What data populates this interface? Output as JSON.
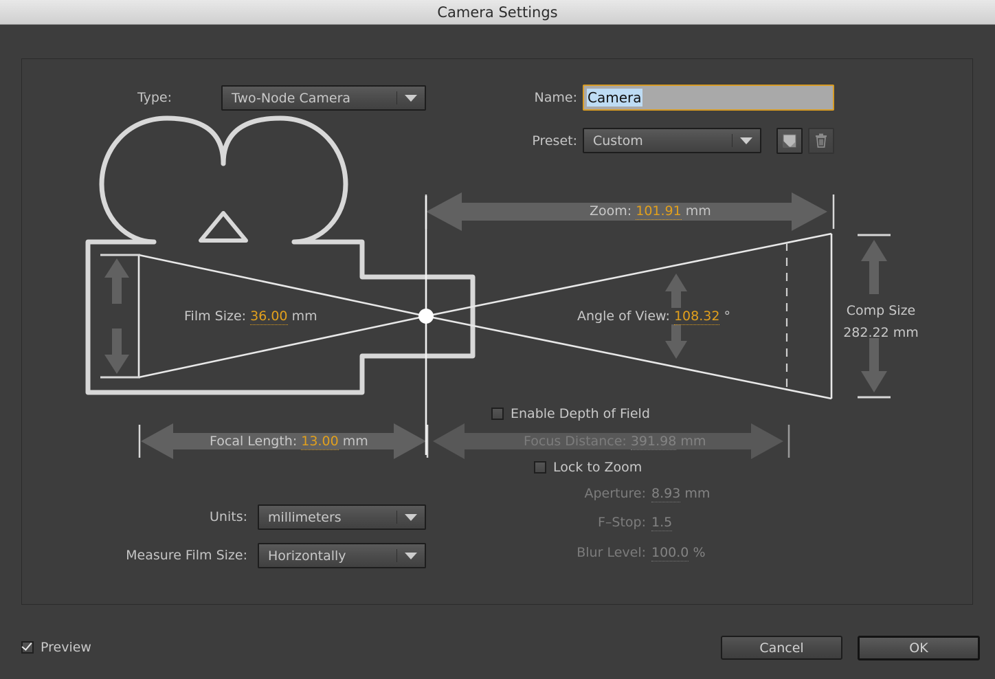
{
  "window": {
    "title": "Camera Settings"
  },
  "form": {
    "type_label": "Type:",
    "type_value": "Two-Node Camera",
    "name_label": "Name:",
    "name_value": "Camera",
    "name_placeholder": "Camera",
    "preset_label": "Preset:",
    "preset_value": "Custom",
    "save_preset_icon": "save-preset-icon",
    "delete_preset_icon": "trash-icon",
    "units_label": "Units:",
    "units_value": "millimeters",
    "measure_film_size_label": "Measure Film Size:",
    "measure_film_size_value": "Horizontally"
  },
  "diagram": {
    "zoom_label": "Zoom:",
    "zoom_value": "101.91",
    "zoom_unit": "mm",
    "film_size_label": "Film Size:",
    "film_size_value": "36.00",
    "film_size_unit": "mm",
    "angle_of_view_label": "Angle of View:",
    "angle_of_view_value": "108.32",
    "angle_of_view_unit": "°",
    "comp_size_label": "Comp Size",
    "comp_size_value": "282.22 mm",
    "focal_length_label": "Focal Length:",
    "focal_length_value": "13.00",
    "focal_length_unit": "mm",
    "focus_distance_label": "Focus Distance:",
    "focus_distance_value": "391.98",
    "focus_distance_unit": "mm"
  },
  "dof": {
    "enable_label": "Enable Depth of Field",
    "enable_checked": false,
    "lock_to_zoom_label": "Lock to Zoom",
    "lock_to_zoom_checked": false,
    "aperture_label": "Aperture:",
    "aperture_value": "8.93",
    "aperture_unit": "mm",
    "fstop_label": "F–Stop:",
    "fstop_value": "1.5",
    "blur_label": "Blur Level:",
    "blur_value": "100.0",
    "blur_unit": "%"
  },
  "footer": {
    "preview_label": "Preview",
    "preview_checked": true,
    "cancel_label": "Cancel",
    "ok_label": "OK"
  },
  "colors": {
    "accent_orange": "#e2a01c",
    "panel_bg": "#3d3d3d",
    "arrow_gray": "#616161",
    "diagram_stroke": "#d8d8d8",
    "focus_border": "#d79b24",
    "selection_blue": "#bedcf4"
  }
}
